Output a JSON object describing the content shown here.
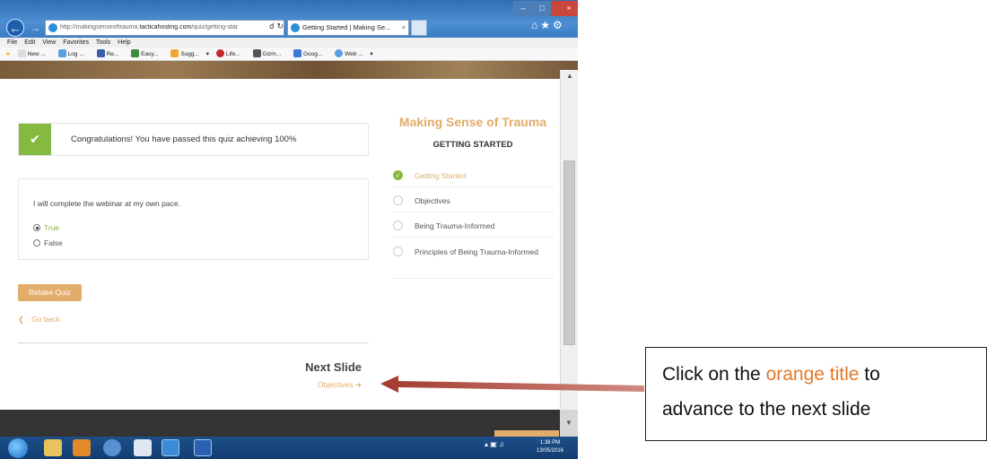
{
  "browser": {
    "url_prefix": "http://makingsenseoftrauma.",
    "url_host": "tacticahosting.com",
    "url_path": "/quiz/getting-star",
    "tab_title": "Getting Started | Making Se...",
    "menu": [
      "File",
      "Edit",
      "View",
      "Favorites",
      "Tools",
      "Help"
    ],
    "favorites": [
      "New ...",
      "Log ...",
      "Re...",
      "Easy...",
      "Sugg...",
      "Life...",
      "Gizm...",
      "Goog...",
      "Web ..."
    ]
  },
  "quiz": {
    "result_message": "Congratulations! You have passed this quiz achieving 100%",
    "question": "I will complete the webinar at my own pace.",
    "options": [
      {
        "label": "True",
        "selected": true
      },
      {
        "label": "False",
        "selected": false
      }
    ],
    "retake_label": "Retake Quiz",
    "go_back_label": "Go back",
    "next_heading": "Next Slide",
    "next_link": "Objectives"
  },
  "sidebar": {
    "course_title": "Making Sense of Trauma",
    "section_title": "GETTING STARTED",
    "items": [
      {
        "label": "Getting Started",
        "done": true,
        "current": true
      },
      {
        "label": "Objectives",
        "done": false,
        "current": false
      },
      {
        "label": "Being Trauma-Informed",
        "done": false,
        "current": false
      },
      {
        "label": "Principles of Being Trauma-Informed",
        "done": false,
        "current": false
      }
    ]
  },
  "taskbar": {
    "time": "1:38 PM",
    "date": "13/05/2016"
  },
  "annotation": {
    "pre": "Click on the ",
    "highlight": "orange title",
    "post": " to",
    "line2": "advance to the next slide"
  },
  "colors": {
    "accent_orange": "#e2ad6b",
    "success_green": "#86b93f",
    "arrow_red": "#b23b32"
  }
}
